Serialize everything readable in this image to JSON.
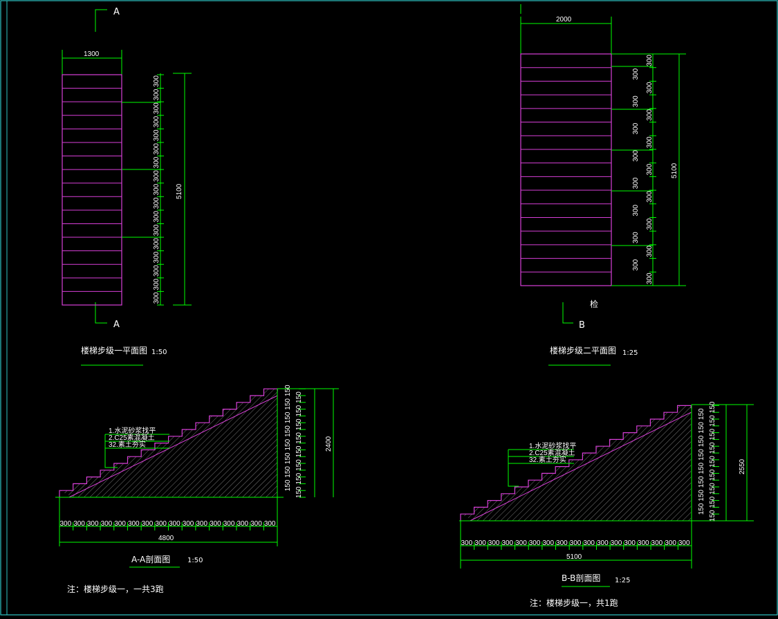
{
  "colors": {
    "background": "#000000",
    "frame": "#2ec4c4",
    "stair_outline": "#d83fd8",
    "dimension": "#00ff00",
    "text": "#ffffff",
    "hatch": "#7a7a7a"
  },
  "plan1": {
    "section_mark": "A",
    "width_dim": "1300",
    "height_dim": "5100",
    "tread_dim": "300",
    "title": "楼梯步级一平面图",
    "scale": "1:50"
  },
  "plan2": {
    "section_mark": "B",
    "width_dim": "2000",
    "height_dim": "5100",
    "tread_dim": "300",
    "note": "检",
    "title": "楼梯步级二平面图",
    "scale": "1:25"
  },
  "sectionA": {
    "title": "A-A剖面图",
    "scale": "1:50",
    "total_length": "4800",
    "total_height": "2400",
    "tread_dim": "300",
    "riser_dim": "150",
    "layers": [
      "1.水泥砂浆找平",
      "2.C25素混凝土",
      "32.素土夯实"
    ],
    "note": "注：楼梯步级一，一共3跑"
  },
  "sectionB": {
    "title": "B-B剖面图",
    "scale": "1:25",
    "total_length": "5100",
    "total_height": "2550",
    "tread_dim": "300",
    "riser_dim": "150",
    "layers": [
      "1.水泥砂浆找平",
      "2.C25素混凝土",
      "32.素土夯实"
    ],
    "note": "注：楼梯步级一，共1跑"
  }
}
